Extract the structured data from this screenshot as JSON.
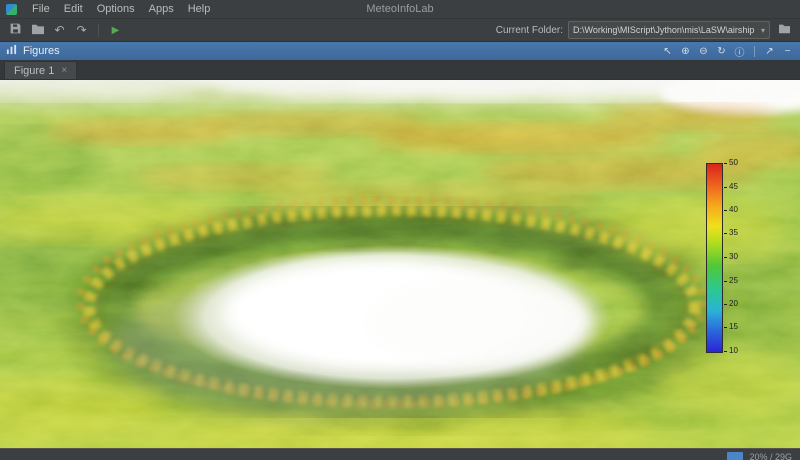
{
  "window": {
    "title": "MeteoInfoLab"
  },
  "menu": {
    "items": [
      "File",
      "Edit",
      "Options",
      "Apps",
      "Help"
    ]
  },
  "toolbar": {
    "current_folder_label": "Current Folder:",
    "current_folder_value": "D:\\Working\\MIScript\\Jython\\mis\\LaSW\\airship",
    "icons": {
      "undo": "↶",
      "redo": "↷",
      "run": "▶",
      "chevron": "▾"
    }
  },
  "figures_panel": {
    "title": "Figures",
    "icons": {
      "pointer": "↖",
      "zoom_in": "⊕",
      "zoom_out": "⊖",
      "rotate": "↻",
      "info": "ⓘ",
      "float": "↗",
      "minimize": "−"
    }
  },
  "tab": {
    "label": "Figure 1",
    "close": "×"
  },
  "figure": {
    "colorbar": {
      "max": 50,
      "min": 10,
      "ticks": [
        50,
        45,
        40,
        35,
        30,
        25,
        20,
        15,
        10
      ]
    }
  },
  "statusbar": {
    "memory": "20% / 29G"
  },
  "colors": {
    "header_accent": "#4576ad",
    "run_green": "#54a857",
    "memory_blue": "#4a86c8"
  }
}
